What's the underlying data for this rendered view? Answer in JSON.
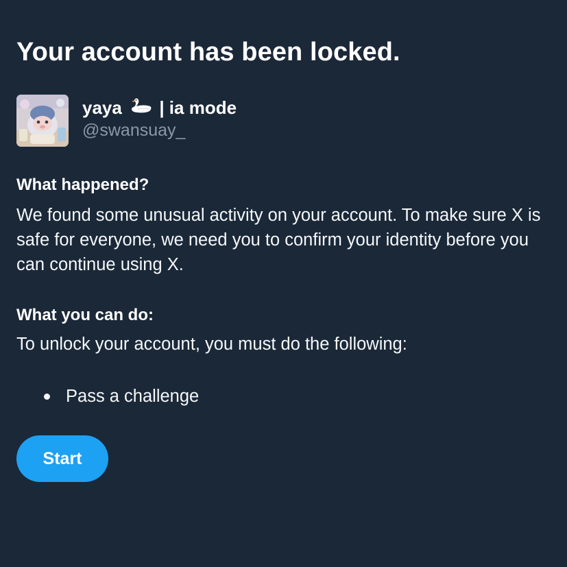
{
  "heading": "Your account has been locked.",
  "account": {
    "name_prefix": "yaya",
    "name_suffix": "| ia mode",
    "name_emoji_icon": "swan-emoji",
    "handle": "@swansuay_",
    "avatar_icon": "avatar"
  },
  "sections": {
    "what_happened": {
      "heading": "What happened?",
      "body": "We found some unusual activity on your account. To make sure X is safe for everyone, we need you to confirm your identity before you can continue using X."
    },
    "what_you_can_do": {
      "heading": "What you can do:",
      "body": "To unlock your account, you must do the following:",
      "steps": [
        "Pass a challenge"
      ]
    }
  },
  "start_button": "Start",
  "colors": {
    "background": "#1b2838",
    "accent": "#1da1f2",
    "handle": "#8899a6"
  }
}
